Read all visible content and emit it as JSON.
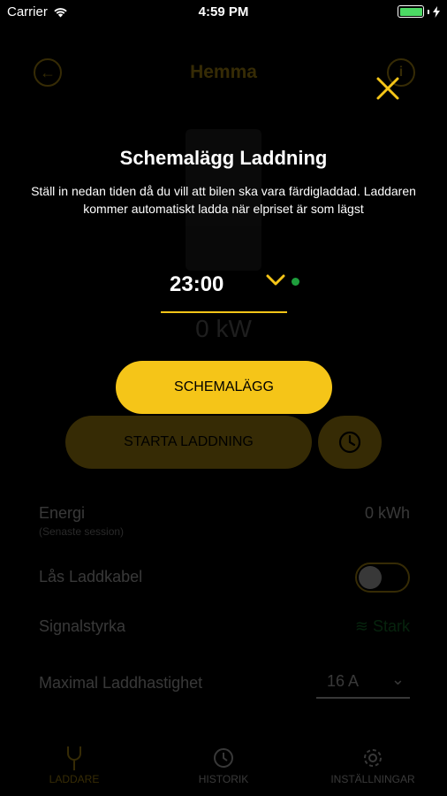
{
  "status_bar": {
    "carrier": "Carrier",
    "time": "4:59 PM",
    "battery_color": "#4cd964"
  },
  "background": {
    "header": {
      "title": "Hemma",
      "back_icon": "back-arrow-icon",
      "info_icon": "info-icon"
    },
    "power_value": "0 kW",
    "start_button_label": "STARTA LADDNING",
    "clock_icon": "clock-icon",
    "energy": {
      "label": "Energi",
      "sublabel": "(Senaste session)",
      "value": "0 kWh"
    },
    "cable_lock": {
      "label": "Lås Laddkabel",
      "enabled": false
    },
    "signal": {
      "label": "Signalstyrka",
      "value": "Stark",
      "icon": "wifi-icon"
    },
    "max_speed": {
      "label": "Maximal Laddhastighet",
      "value": "16 A"
    },
    "tabs": [
      {
        "label": "LADDARE",
        "icon": "charger-plug-icon",
        "active": true
      },
      {
        "label": "HISTORIK",
        "icon": "history-icon",
        "active": false
      },
      {
        "label": "INSTÄLLNINGAR",
        "icon": "gear-icon",
        "active": false
      }
    ]
  },
  "modal": {
    "title": "Schemalägg Laddning",
    "description": "Ställ in nedan tiden då du vill att bilen ska vara färdigladdad. Laddaren kommer automatiskt ladda när elpriset är som lägst",
    "time_value": "23:00",
    "button_label": "SCHEMALÄGG",
    "close_icon": "close-icon"
  },
  "colors": {
    "accent": "#f5c518",
    "background": "#000000",
    "status_dot": "#1e9e3c"
  }
}
